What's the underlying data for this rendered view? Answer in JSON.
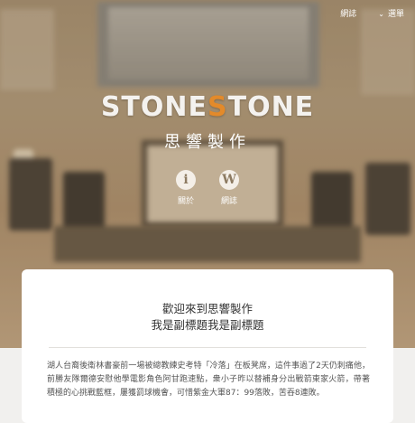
{
  "nav": {
    "blog_label": "網誌",
    "menu_label": "選單",
    "menu_chevron": "chevron-down-icon"
  },
  "brand": {
    "logo_left": "STONE",
    "logo_accent": "S",
    "logo_right": "TONE",
    "chinese_name": "思響製作",
    "accent_color": "#e38a2a"
  },
  "shortcuts": [
    {
      "icon": "info-icon",
      "glyph": "i",
      "label": "關於"
    },
    {
      "icon": "wordpress-icon",
      "glyph": "W",
      "label": "網誌"
    }
  ],
  "welcome": {
    "title": "歡迎來到思響製作",
    "subtitle": "我是副標題我是副標題",
    "body": "湖人台裔後衛林書豪前一場被總教練史考特「冷落」在板凳席，這件事過了2天仍刺痛他，前勝友隊爾德安慰他學電影角色阿甘跑速點，衆小子昨以替補身分出戰箭東家火箭，帶著積極的心挑戰藍框，屢獲罰球機會，可惜紫金大軍87：99落敗，苦吞8連敗。"
  }
}
